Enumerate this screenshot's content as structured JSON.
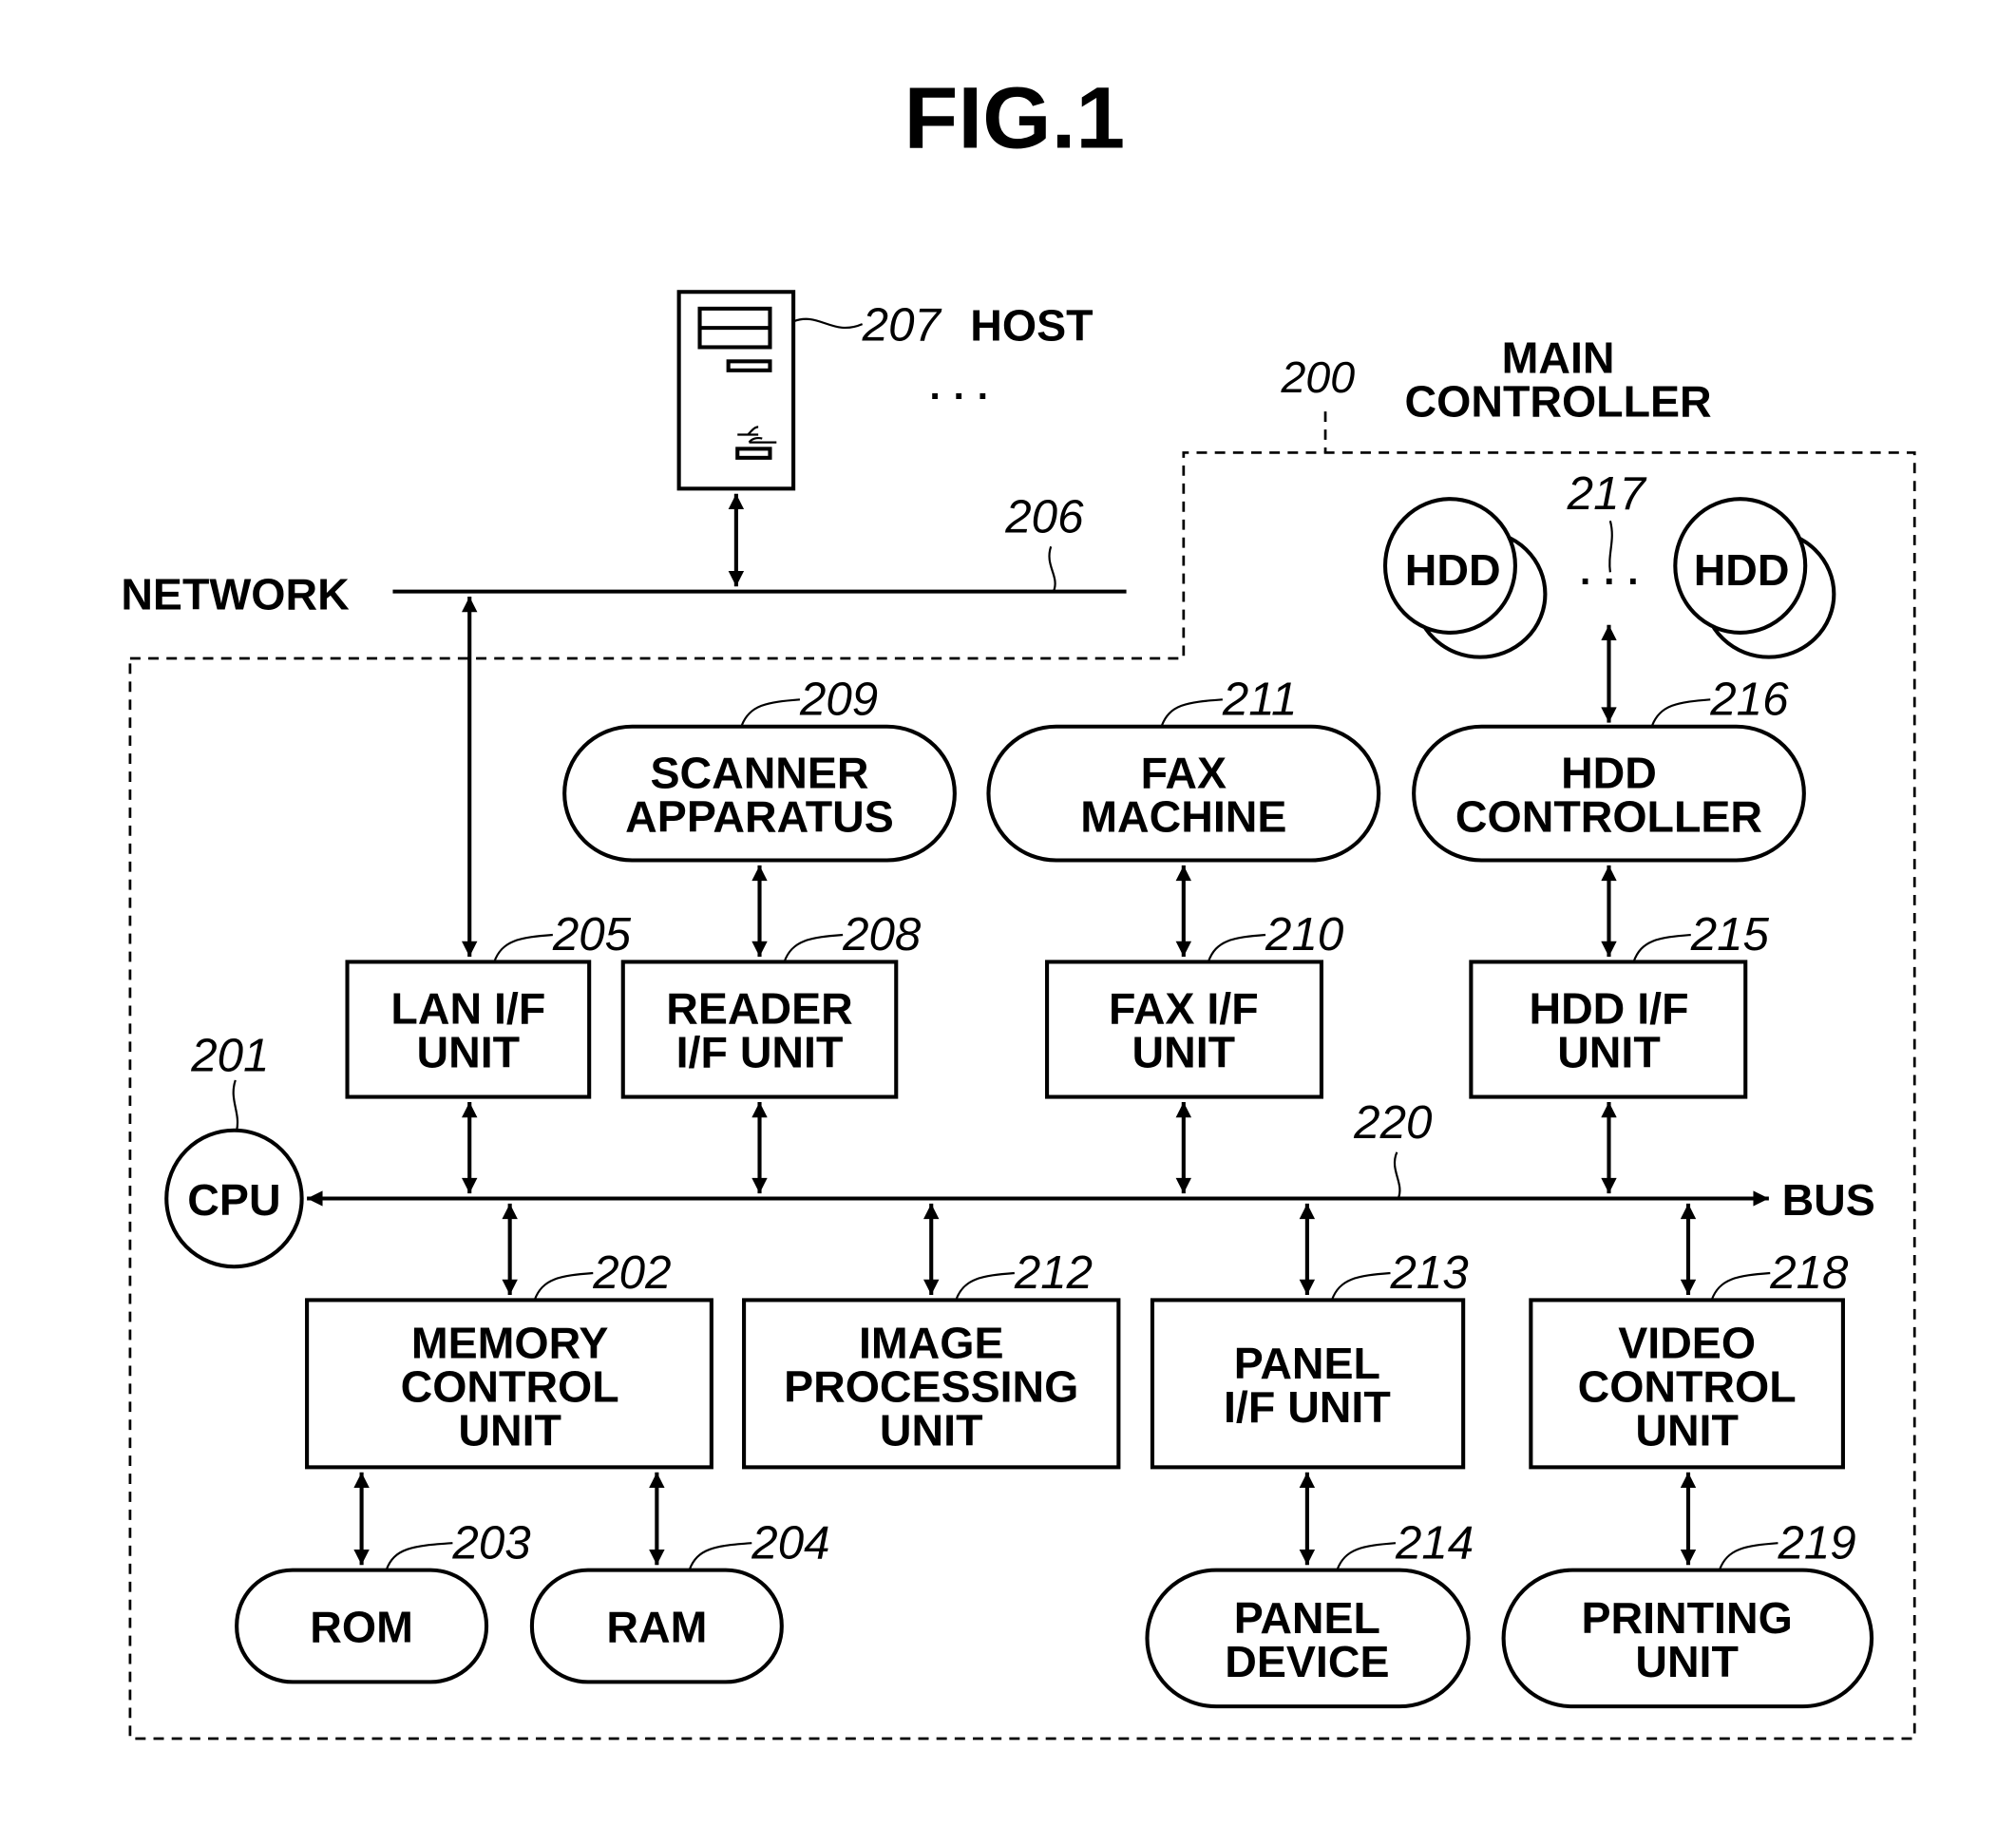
{
  "figure": {
    "title": "FIG.1"
  },
  "network": {
    "label": "NETWORK",
    "ref": "206"
  },
  "host": {
    "ref": "207",
    "label": "HOST",
    "ellipsis": "· · ·"
  },
  "main_controller": {
    "ref": "200",
    "label_line1": "MAIN",
    "label_line2": "CONTROLLER"
  },
  "bus": {
    "label": "BUS",
    "ref": "220"
  },
  "cpu": {
    "label": "CPU",
    "ref": "201"
  },
  "hdd_group": {
    "ref": "217",
    "hdd_label": "HDD",
    "ellipsis": "· · ·"
  },
  "blocks": {
    "lan_if": {
      "ref": "205",
      "line1": "LAN I/F",
      "line2": "UNIT"
    },
    "reader_if": {
      "ref": "208",
      "line1": "READER",
      "line2": "I/F UNIT"
    },
    "fax_if": {
      "ref": "210",
      "line1": "FAX I/F",
      "line2": "UNIT"
    },
    "hdd_if": {
      "ref": "215",
      "line1": "HDD I/F",
      "line2": "UNIT"
    },
    "scanner": {
      "ref": "209",
      "line1": "SCANNER",
      "line2": "APPARATUS"
    },
    "fax_machine": {
      "ref": "211",
      "line1": "FAX",
      "line2": "MACHINE"
    },
    "hdd_controller": {
      "ref": "216",
      "line1": "HDD",
      "line2": "CONTROLLER"
    },
    "memory_control": {
      "ref": "202",
      "line1": "MEMORY",
      "line2": "CONTROL",
      "line3": "UNIT"
    },
    "image_processing": {
      "ref": "212",
      "line1": "IMAGE",
      "line2": "PROCESSING",
      "line3": "UNIT"
    },
    "panel_if": {
      "ref": "213",
      "line1": "PANEL",
      "line2": "I/F UNIT"
    },
    "video_control": {
      "ref": "218",
      "line1": "VIDEO",
      "line2": "CONTROL",
      "line3": "UNIT"
    },
    "rom": {
      "ref": "203",
      "line1": "ROM"
    },
    "ram": {
      "ref": "204",
      "line1": "RAM"
    },
    "panel_device": {
      "ref": "214",
      "line1": "PANEL",
      "line2": "DEVICE"
    },
    "printing_unit": {
      "ref": "219",
      "line1": "PRINTING",
      "line2": "UNIT"
    }
  }
}
